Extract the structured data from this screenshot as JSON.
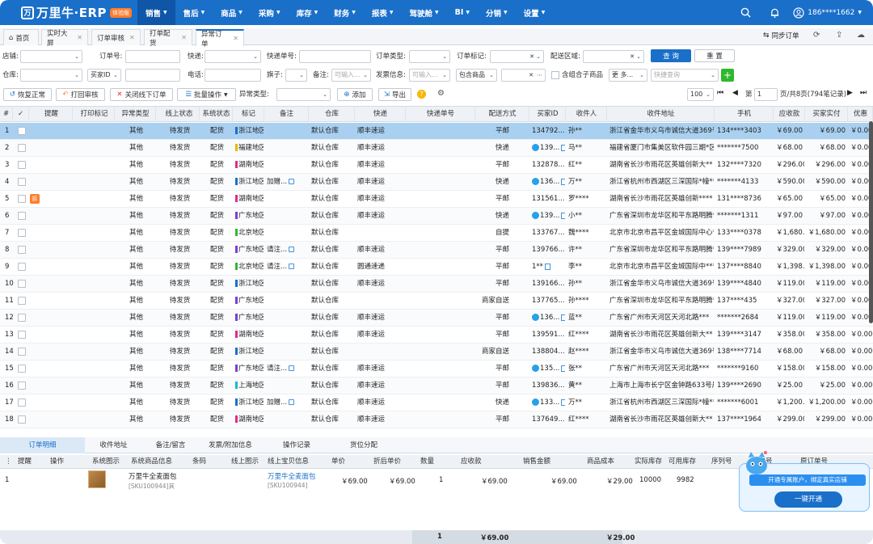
{
  "app": {
    "name": "万里牛·ERP",
    "tag": "体验版",
    "user": "186****1662"
  },
  "nav": [
    "销售",
    "售后",
    "商品",
    "采购",
    "库存",
    "财务",
    "报表",
    "驾驶舱",
    "BI",
    "分销",
    "设置"
  ],
  "tabs": [
    {
      "label": "首页",
      "closable": false
    },
    {
      "label": "实时大屏",
      "closable": true
    },
    {
      "label": "订单审核",
      "closable": true
    },
    {
      "label": "打单配货",
      "closable": true
    },
    {
      "label": "异常订单",
      "closable": true
    }
  ],
  "tabbar_right": {
    "sync_label": "同步订单"
  },
  "filters": {
    "shop": "店铺:",
    "order_no": "订单号:",
    "express": "快递:",
    "express_no": "快递单号:",
    "order_type": "订单类型:",
    "order_mark": "订单标记:",
    "delivery_area": "配送区域:",
    "query": "查 询",
    "reset": "重 置",
    "warehouse": "仓库:",
    "buyer_id": "买家ID",
    "phone": "电话:",
    "flag": "旗子:",
    "remark": "备注:",
    "remark_ph": "可输入...",
    "invoice": "发票信息:",
    "invoice_ph": "可输入...",
    "contains_goods": "包含商品",
    "combo_label": "含组合子商品",
    "more": "更 多...",
    "fast_query_ph": "快捷查询"
  },
  "actions": {
    "restore": "恢复正常",
    "print_review": "打回审核",
    "close_offline": "关闭线下订单",
    "batch": "批量操作",
    "abnormal_type": "异常类型:",
    "add": "添加",
    "export": "导出",
    "page_size": "100",
    "page_prefix": "第",
    "page_no": "1",
    "page_suffix": "页/共8页(794笔记录)"
  },
  "columns": [
    "提醒",
    "打印标记",
    "异常类型",
    "线上状态",
    "系统状态",
    "标记",
    "备注",
    "仓库",
    "快递",
    "快递单号",
    "配送方式",
    "买家ID",
    "收件人",
    "收件地址",
    "手机",
    "应收款",
    "买家实付",
    "优惠"
  ],
  "rows": [
    {
      "no": "1",
      "type": "其他",
      "online": "待发货",
      "sys": "配货",
      "flag": "浙江地区",
      "flagc": "#1a6fc9",
      "remark": "",
      "wh": "默认仓库",
      "exp": "顺丰速运",
      "ship": "平邮",
      "buyer": "134792...",
      "ww": false,
      "rcv": "孙**",
      "addr": "浙江省金华市义乌市诚信大道369号",
      "phone": "134****3403",
      "due": "￥69.00",
      "paid": "￥69.00",
      "disc": "￥0.00"
    },
    {
      "no": "2",
      "type": "其他",
      "online": "待发货",
      "sys": "配货",
      "flag": "福建地区",
      "flagc": "#e8b800",
      "remark": "",
      "wh": "默认仓库",
      "exp": "顺丰速运",
      "ship": "快递",
      "buyer": "139...",
      "ww": true,
      "rcv": "马**",
      "addr": "福建省厦门市集美区软件园三期*区",
      "phone": "*******7500",
      "due": "￥68.00",
      "paid": "￥68.00",
      "disc": "￥0.00"
    },
    {
      "no": "3",
      "type": "其他",
      "online": "待发货",
      "sys": "配货",
      "flag": "湖南地区",
      "flagc": "#e02b8a",
      "remark": "",
      "wh": "默认仓库",
      "exp": "顺丰速运",
      "ship": "平邮",
      "buyer": "132878...",
      "ww": false,
      "rcv": "红**",
      "addr": "湖南省长沙市雨花区英雄创新大**",
      "phone": "132****7320",
      "due": "￥296.00",
      "paid": "￥296.00",
      "disc": "￥0.00"
    },
    {
      "no": "4",
      "type": "其他",
      "online": "待发货",
      "sys": "配货",
      "flag": "浙江地区",
      "flagc": "#1a6fc9",
      "remark": "加赠...",
      "wh": "默认仓库",
      "exp": "顺丰速运",
      "ship": "快递",
      "buyer": "136...",
      "ww": true,
      "rcv": "万**",
      "addr": "浙江省杭州市西湖区三深国际*幢**",
      "phone": "*******4133",
      "due": "￥590.00",
      "paid": "￥590.00",
      "disc": "￥0.00"
    },
    {
      "no": "5",
      "type": "其他",
      "online": "待发货",
      "sys": "配货",
      "flag": "湖南地区",
      "flagc": "#e02b8a",
      "remark": "",
      "wh": "默认仓库",
      "exp": "顺丰速运",
      "ship": "平邮",
      "buyer": "131561...",
      "ww": false,
      "rcv": "罗****",
      "addr": "湖南省长沙市雨花区英雄创新****",
      "phone": "131****8736",
      "due": "￥65.00",
      "paid": "￥65.00",
      "disc": "￥0.00",
      "badge": "拆"
    },
    {
      "no": "6",
      "type": "其他",
      "online": "待发货",
      "sys": "配货",
      "flag": "广东地区",
      "flagc": "#7b3fd1",
      "remark": "",
      "wh": "默认仓库",
      "exp": "顺丰速运",
      "ship": "快递",
      "buyer": "139...",
      "ww": true,
      "rcv": "小**",
      "addr": "广东省深圳市龙华区和平东路明腾**",
      "phone": "*******1311",
      "due": "￥97.00",
      "paid": "￥97.00",
      "disc": "￥0.00"
    },
    {
      "no": "7",
      "type": "其他",
      "online": "待发货",
      "sys": "配货",
      "flag": "北京地区",
      "flagc": "#2fb82f",
      "remark": "",
      "wh": "默认仓库",
      "exp": "",
      "ship": "自提",
      "buyer": "133767...",
      "ww": false,
      "rcv": "魏****",
      "addr": "北京市北京市昌平区金城国际中心**",
      "phone": "133****0378",
      "due": "￥1,680.00",
      "paid": "￥1,680.00",
      "disc": "￥0.00"
    },
    {
      "no": "8",
      "type": "其他",
      "online": "待发货",
      "sys": "配货",
      "flag": "广东地区",
      "flagc": "#7b3fd1",
      "remark": "请注...",
      "wh": "默认仓库",
      "exp": "顺丰速运",
      "ship": "平邮",
      "buyer": "139766...",
      "ww": false,
      "rcv": "许**",
      "addr": "广东省深圳市龙华区和平东路明腾**",
      "phone": "139****7989",
      "due": "￥329.00",
      "paid": "￥329.00",
      "disc": "￥0.00"
    },
    {
      "no": "9",
      "type": "其他",
      "online": "待发货",
      "sys": "配货",
      "flag": "北京地区",
      "flagc": "#2fb82f",
      "remark": "请注...",
      "wh": "默认仓库",
      "exp": "圆通速递",
      "ship": "平邮",
      "buyer": "1**",
      "ww": false,
      "rcv": "李**",
      "addr": "北京市北京市昌平区金城国际中***",
      "phone": "137****8840",
      "due": "￥1,398.00",
      "paid": "￥1,398.00",
      "disc": "￥0.00"
    },
    {
      "no": "10",
      "type": "其他",
      "online": "待发货",
      "sys": "配货",
      "flag": "浙江地区",
      "flagc": "#1a6fc9",
      "remark": "",
      "wh": "默认仓库",
      "exp": "顺丰速运",
      "ship": "平邮",
      "buyer": "139166...",
      "ww": false,
      "rcv": "孙**",
      "addr": "浙江省金华市义乌市诚信大道369号",
      "phone": "139****4840",
      "due": "￥119.00",
      "paid": "￥119.00",
      "disc": "￥0.00"
    },
    {
      "no": "11",
      "type": "其他",
      "online": "待发货",
      "sys": "配货",
      "flag": "广东地区",
      "flagc": "#7b3fd1",
      "remark": "",
      "wh": "默认仓库",
      "exp": "",
      "ship": "商家自送",
      "buyer": "137765...",
      "ww": false,
      "rcv": "孙****",
      "addr": "广东省深圳市龙华区和平东路明腾**",
      "phone": "137****435",
      "due": "￥327.00",
      "paid": "￥327.00",
      "disc": "￥0.00"
    },
    {
      "no": "12",
      "type": "其他",
      "online": "待发货",
      "sys": "配货",
      "flag": "广东地区",
      "flagc": "#7b3fd1",
      "remark": "",
      "wh": "默认仓库",
      "exp": "顺丰速运",
      "ship": "平邮",
      "buyer": "136...",
      "ww": true,
      "rcv": "蓝**",
      "addr": "广东省广州市天河区天河北路***",
      "phone": "*******2684",
      "due": "￥119.00",
      "paid": "￥119.00",
      "disc": "￥0.00"
    },
    {
      "no": "13",
      "type": "其他",
      "online": "待发货",
      "sys": "配货",
      "flag": "湖南地区",
      "flagc": "#e02b8a",
      "remark": "",
      "wh": "默认仓库",
      "exp": "顺丰速运",
      "ship": "平邮",
      "buyer": "139591...",
      "ww": false,
      "rcv": "红****",
      "addr": "湖南省长沙市雨花区英雄创新大**",
      "phone": "139****3147",
      "due": "￥358.00",
      "paid": "￥358.00",
      "disc": "￥0.00"
    },
    {
      "no": "14",
      "type": "其他",
      "online": "待发货",
      "sys": "配货",
      "flag": "浙江地区",
      "flagc": "#1a6fc9",
      "remark": "",
      "wh": "默认仓库",
      "exp": "",
      "ship": "商家自送",
      "buyer": "138804...",
      "ww": false,
      "rcv": "赵****",
      "addr": "浙江省金华市义乌市诚信大道369号",
      "phone": "138****7714",
      "due": "￥68.00",
      "paid": "￥68.00",
      "disc": "￥0.00"
    },
    {
      "no": "15",
      "type": "其他",
      "online": "待发货",
      "sys": "配货",
      "flag": "广东地区",
      "flagc": "#7b3fd1",
      "remark": "请注...",
      "wh": "默认仓库",
      "exp": "顺丰速运",
      "ship": "平邮",
      "buyer": "135...",
      "ww": true,
      "rcv": "张**",
      "addr": "广东省广州市天河区天河北路***",
      "phone": "*******9160",
      "due": "￥158.00",
      "paid": "￥158.00",
      "disc": "￥0.00"
    },
    {
      "no": "16",
      "type": "其他",
      "online": "待发货",
      "sys": "配货",
      "flag": "上海地区",
      "flagc": "#1fb7c9",
      "remark": "",
      "wh": "默认仓库",
      "exp": "顺丰速运",
      "ship": "平邮",
      "buyer": "139836...",
      "ww": false,
      "rcv": "黄**",
      "addr": "上海市上海市长宁区金钟路633号晨**",
      "phone": "139****2690",
      "due": "￥25.00",
      "paid": "￥25.00",
      "disc": "￥0.00"
    },
    {
      "no": "17",
      "type": "其他",
      "online": "待发货",
      "sys": "配货",
      "flag": "浙江地区",
      "flagc": "#1a6fc9",
      "remark": "加赠...",
      "wh": "默认仓库",
      "exp": "顺丰速运",
      "ship": "快递",
      "buyer": "133...",
      "ww": true,
      "rcv": "万**",
      "addr": "浙江省杭州市西湖区三深国际*幢**",
      "phone": "*******6001",
      "due": "￥1,200.00",
      "paid": "￥1,200.00",
      "disc": "￥0.00"
    },
    {
      "no": "18",
      "type": "其他",
      "online": "待发货",
      "sys": "配货",
      "flag": "湖南地区",
      "flagc": "#e02b8a",
      "remark": "",
      "wh": "默认仓库",
      "exp": "顺丰速运",
      "ship": "平邮",
      "buyer": "137649...",
      "ww": false,
      "rcv": "红****",
      "addr": "湖南省长沙市雨花区英雄创新大**",
      "phone": "137****1964",
      "due": "￥299.00",
      "paid": "￥299.00",
      "disc": "￥0.00"
    }
  ],
  "bottom_tabs": [
    "订单明细",
    "收件地址",
    "备注/留言",
    "发票/附加信息",
    "操作记录",
    "货位分配"
  ],
  "detail_columns": [
    "提醒",
    "操作",
    "系统图示",
    "系统商品信息",
    "条码",
    "线上图示",
    "线上宝贝信息",
    "单价",
    "折后单价",
    "数量",
    "应收款",
    "销售金额",
    "商品成本",
    "实际库存",
    "可用库存",
    "序列号",
    "批次号",
    "原订单号"
  ],
  "detail": {
    "no": "1",
    "sys_name": "万里牛全麦面包",
    "sys_sku": "[SKU100944]其",
    "online_name": "万里牛全麦面包",
    "online_sku": "[SKU100944]",
    "price": "￥69.00",
    "disc_price": "￥69.00",
    "qty": "1",
    "due": "￥69.00",
    "sales": "￥69.00",
    "cost": "￥29.00",
    "stock": "10000",
    "avail": "9982"
  },
  "summary": {
    "qty": "1",
    "due": "￥69.00",
    "cost": "￥29.00"
  },
  "promo": {
    "text": "开通专属账户，绑定真实店铺",
    "button": "一键开通"
  }
}
